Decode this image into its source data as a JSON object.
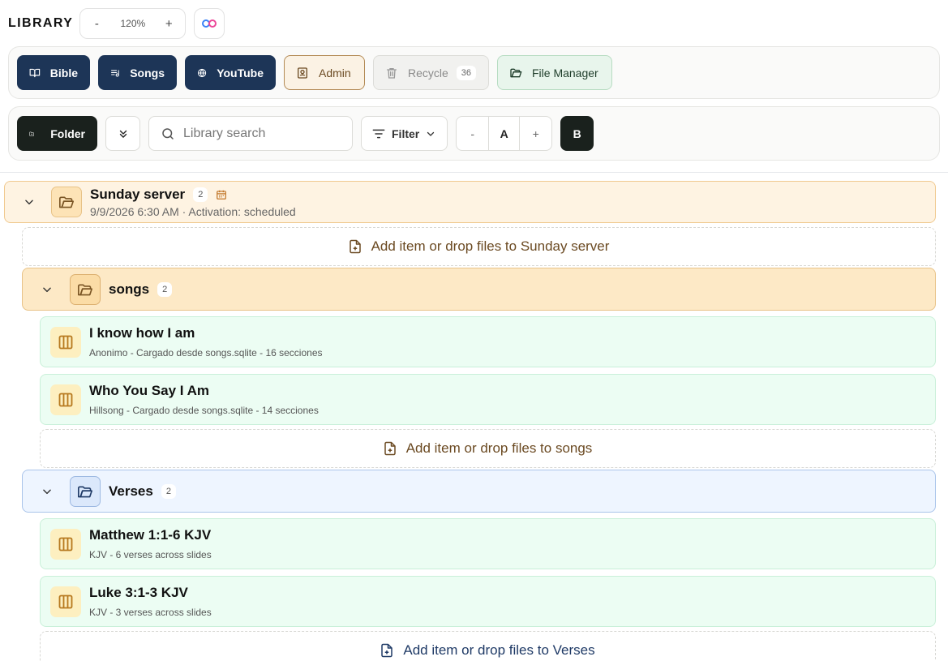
{
  "header": {
    "title": "LIBRARY",
    "zoom_minus": "-",
    "zoom_value": "120%",
    "zoom_plus": "+"
  },
  "nav": {
    "bible": "Bible",
    "songs": "Songs",
    "youtube": "YouTube",
    "admin": "Admin",
    "recycle": "Recycle",
    "recycle_count": "36",
    "file_manager": "File Manager"
  },
  "toolbar": {
    "folder": "Folder",
    "search_placeholder": "Library search",
    "filter": "Filter",
    "font_minus": "-",
    "font_reset": "A",
    "font_plus": "+",
    "bold": "B"
  },
  "tree": {
    "sunday": {
      "name": "Sunday server",
      "count": "2",
      "meta": "9/9/2026 6:30 AM · Activation: scheduled",
      "add": "Add item or drop files to Sunday server"
    },
    "songs": {
      "name": "songs",
      "count": "2",
      "items": [
        {
          "title": "I know how I am",
          "sub": "Anonimo - Cargado desde songs.sqlite - 16 secciones"
        },
        {
          "title": "Who You Say I Am",
          "sub": "Hillsong - Cargado desde songs.sqlite - 14 secciones"
        }
      ],
      "add": "Add item or drop files to songs"
    },
    "verses": {
      "name": "Verses",
      "count": "2",
      "items": [
        {
          "title": "Matthew 1:1-6 KJV",
          "sub": "KJV - 6 verses across slides"
        },
        {
          "title": "Luke 3:1-3 KJV",
          "sub": "KJV - 3 verses across slides"
        }
      ],
      "add": "Add item or drop files to Verses"
    }
  },
  "colors": {
    "navy": "#1d3557",
    "dark": "#1a211d",
    "folder_amber": "#fde9c6",
    "folder_blue": "#eef5ff",
    "item_green": "#ecfdf3"
  }
}
